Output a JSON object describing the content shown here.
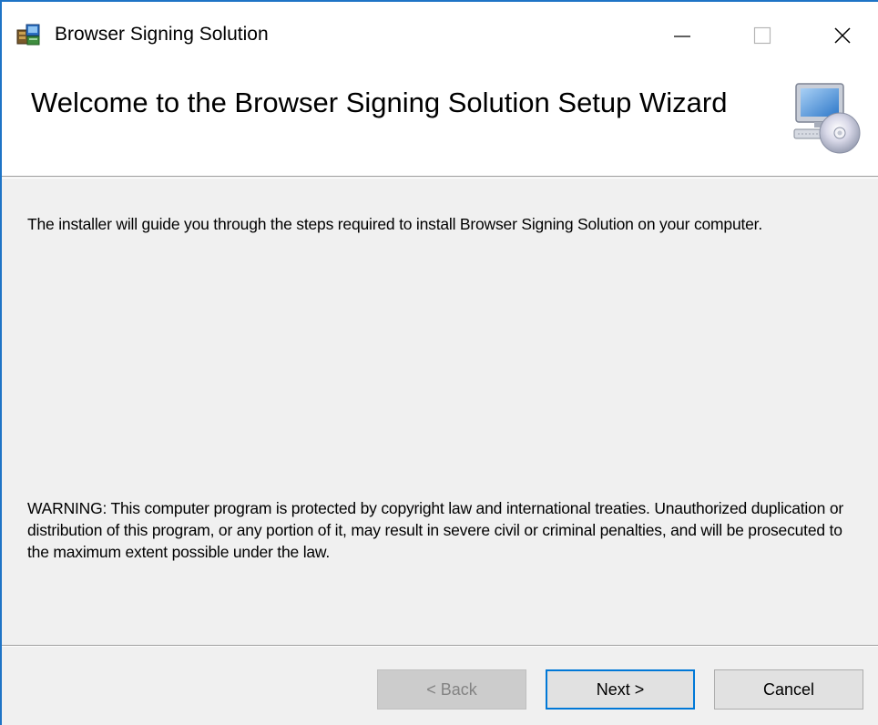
{
  "window": {
    "title": "Browser Signing Solution"
  },
  "banner": {
    "title": "Welcome to the Browser Signing Solution Setup Wizard",
    "icon": "computer-cd-icon"
  },
  "body": {
    "intro": "The installer will guide you through the steps required to install Browser Signing Solution on your computer.",
    "warning": "WARNING: This computer program is protected by copyright law and international treaties. Unauthorized duplication or distribution of this program, or any portion of it, may result in severe civil or criminal penalties, and will be prosecuted to the maximum extent possible under the law."
  },
  "buttons": {
    "back": "< Back",
    "next": "Next >",
    "cancel": "Cancel"
  },
  "icons": {
    "app": "installer-package-icon",
    "minimize": "minimize-icon",
    "maximize": "maximize-icon",
    "close": "close-icon"
  },
  "colors": {
    "window_border": "#1e74c6",
    "default_button_border": "#0078d7",
    "disabled_text": "#838383"
  }
}
